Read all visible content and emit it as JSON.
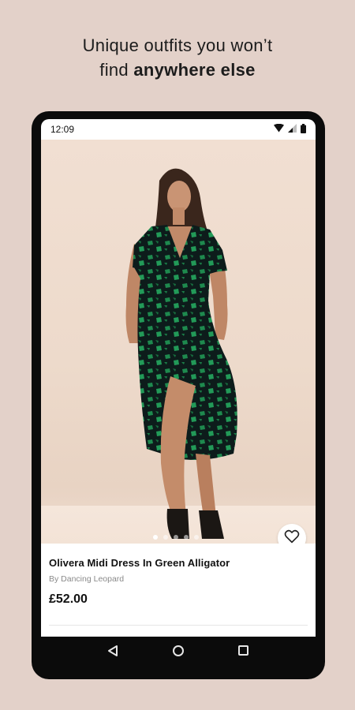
{
  "headline": {
    "line1": "Unique outfits you won’t",
    "line2_regular": "find ",
    "line2_bold": "anywhere else"
  },
  "status_bar": {
    "time": "12:09",
    "icons": [
      "wifi-icon",
      "signal-icon",
      "battery-icon"
    ]
  },
  "gallery": {
    "image_count": 5,
    "active_index": 0
  },
  "product": {
    "name": "Olivera Midi Dress In Green Alligator",
    "brand": "By Dancing Leopard",
    "price": "£52.00",
    "favorite_icon": "heart-outline-icon"
  },
  "nav_bar": {
    "icons": [
      "back-triangle-icon",
      "home-circle-icon",
      "recents-square-icon"
    ]
  },
  "colors": {
    "background": "#e3d1c9",
    "phone_frame": "#0b0b0b",
    "dress": "#0d1c1b",
    "dress_pattern": "#1e8a4e",
    "text": "#111111",
    "muted_text": "#8a8a8a"
  }
}
